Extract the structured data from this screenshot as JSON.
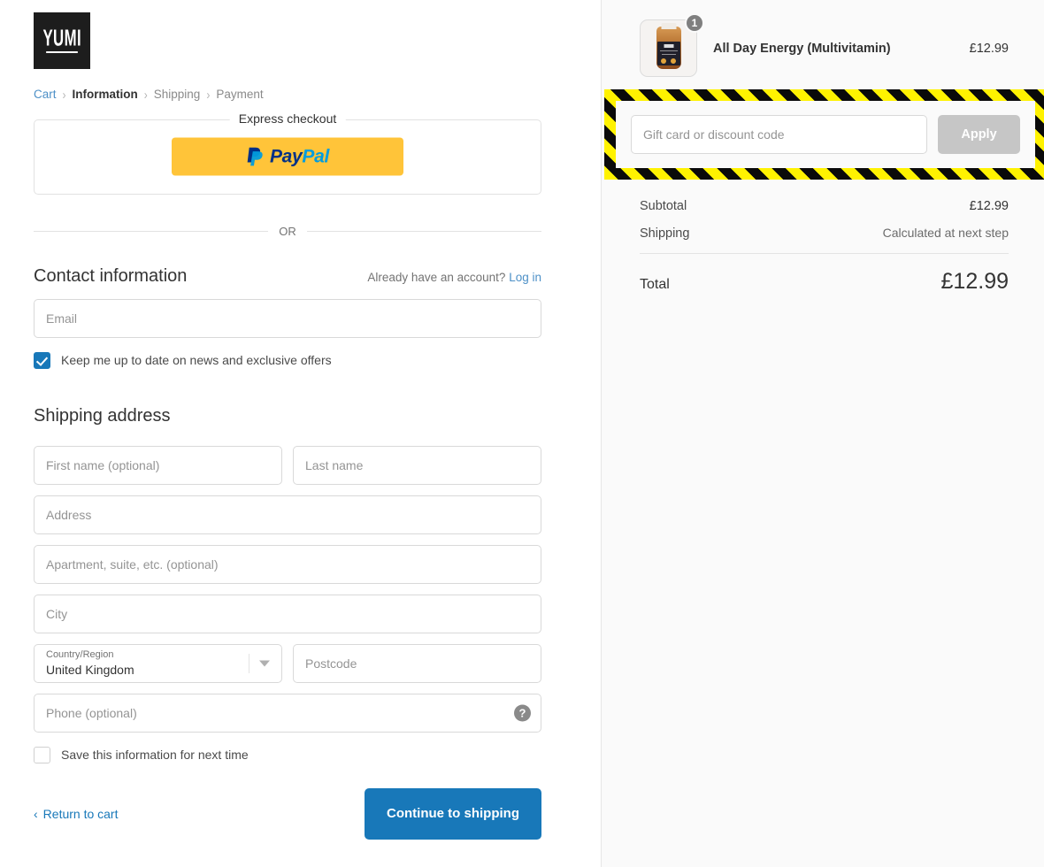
{
  "brand": {
    "logo_text": "YUMI"
  },
  "breadcrumb": {
    "items": [
      {
        "label": "Cart",
        "state": "link"
      },
      {
        "label": "Information",
        "state": "current"
      },
      {
        "label": "Shipping",
        "state": "muted"
      },
      {
        "label": "Payment",
        "state": "muted"
      }
    ],
    "separator": "›"
  },
  "express": {
    "legend": "Express checkout",
    "paypal": {
      "pay": "Pay",
      "pal": "Pal",
      "bg": "#FFC439"
    },
    "or_text": "OR"
  },
  "contact": {
    "title": "Contact information",
    "aside_text": "Already have an account?",
    "login_label": "Log in",
    "email_placeholder": "Email",
    "newsletter_label": "Keep me up to date on news and exclusive offers",
    "newsletter_checked": true
  },
  "shipping": {
    "title": "Shipping address",
    "first_name_placeholder": "First name (optional)",
    "last_name_placeholder": "Last name",
    "address_placeholder": "Address",
    "apartment_placeholder": "Apartment, suite, etc. (optional)",
    "city_placeholder": "City",
    "country_label": "Country/Region",
    "country_value": "United Kingdom",
    "postcode_placeholder": "Postcode",
    "phone_placeholder": "Phone (optional)",
    "phone_help_icon": "?",
    "save_info_label": "Save this information for next time",
    "save_info_checked": false
  },
  "footer": {
    "return_label": "Return to cart",
    "return_chevron": "‹",
    "continue_label": "Continue to shipping",
    "accent_color": "#1878B9"
  },
  "order_summary": {
    "line_items": [
      {
        "name": "All Day Energy (Multivitamin)",
        "price": "£12.99",
        "quantity": "1"
      }
    ],
    "discount": {
      "placeholder": "Gift card or discount code",
      "apply_label": "Apply",
      "apply_disabled": true,
      "highlight_colors": [
        "#FFF200",
        "#0a0a0a"
      ]
    },
    "totals": [
      {
        "label": "Subtotal",
        "value": "£12.99",
        "muted": false
      },
      {
        "label": "Shipping",
        "value": "Calculated at next step",
        "muted": true
      }
    ],
    "grand_total": {
      "label": "Total",
      "value": "£12.99"
    }
  }
}
